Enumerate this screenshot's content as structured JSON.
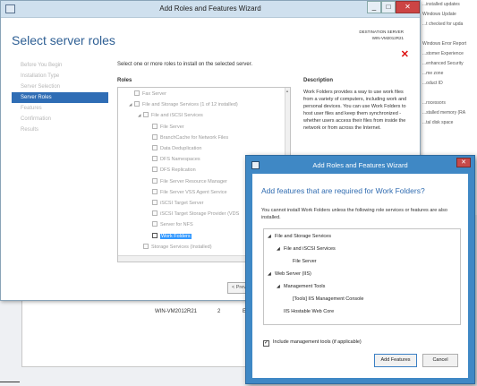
{
  "background": {
    "right_panel_lines": [
      "...installed updates",
      "Windows Update",
      "...t checked for upda",
      "",
      "Windows Error Report",
      "...stomer Experience",
      "...enhanced Security",
      "...me zone",
      "...oduct ID",
      "",
      "...rocessors",
      "...stalled memory (RA",
      "...tal disk space"
    ],
    "table_row": {
      "server": "WIN-VM2012R21",
      "num": "2",
      "col3": "Er"
    }
  },
  "wizard": {
    "title": "Add Roles and Features Wizard",
    "page_title": "Select server roles",
    "destination_label": "DESTINATION SERVER",
    "destination_value": "WIN-VM2012R21",
    "close_glyph": "✕",
    "nav": [
      "Before You Begin",
      "Installation Type",
      "Server Selection",
      "Server Roles",
      "Features",
      "Confirmation",
      "Results"
    ],
    "instruction": "Select one or more roles to install on the selected server.",
    "roles_label": "Roles",
    "description_label": "Description",
    "description": "Work Folders provides a way to use work files from a variety of computers, including work and personal devices. You can use Work Folders to host user files and keep them synchronized - whether users access their files from inside the network or from across the Internet.",
    "roles": [
      {
        "label": "Fax Server",
        "expand": "",
        "indent": 0
      },
      {
        "label": "File and Storage Services (1 of 12 installed)",
        "expand": "◢",
        "indent": 0
      },
      {
        "label": "File and iSCSI Services",
        "expand": "◢",
        "indent": 1
      },
      {
        "label": "File Server",
        "expand": "",
        "indent": 2
      },
      {
        "label": "BranchCache for Network Files",
        "expand": "",
        "indent": 2
      },
      {
        "label": "Data Deduplication",
        "expand": "",
        "indent": 2
      },
      {
        "label": "DFS Namespaces",
        "expand": "",
        "indent": 2
      },
      {
        "label": "DFS Replication",
        "expand": "",
        "indent": 2
      },
      {
        "label": "File Server Resource Manager",
        "expand": "",
        "indent": 2
      },
      {
        "label": "File Server VSS Agent Service",
        "expand": "",
        "indent": 2
      },
      {
        "label": "iSCSI Target Server",
        "expand": "",
        "indent": 2
      },
      {
        "label": "iSCSI Target Storage Provider (VDS",
        "expand": "",
        "indent": 2
      },
      {
        "label": "Server for NFS",
        "expand": "",
        "indent": 2
      },
      {
        "label": "Work Folders",
        "expand": "",
        "indent": 2,
        "selected": true
      },
      {
        "label": "Storage Services (Installed)",
        "expand": "",
        "indent": 1
      }
    ],
    "prev_button": "< Prev",
    "scroll_up": "▲",
    "scroll_down": "▼"
  },
  "dialog": {
    "title": "Add Roles and Features Wizard",
    "close_glyph": "✕",
    "heading": "Add features that are required for Work Folders?",
    "message": "You cannot install Work Folders unless the following role services or features are also installed.",
    "tree": [
      {
        "label": "File and Storage Services",
        "tri": "◢",
        "indent": 0
      },
      {
        "label": "File and iSCSI Services",
        "tri": "◢",
        "indent": 1
      },
      {
        "label": "File Server",
        "tri": "",
        "indent": 2
      },
      {
        "label": "Web Server (IIS)",
        "tri": "◢",
        "indent": 0
      },
      {
        "label": "Management Tools",
        "tri": "◢",
        "indent": 1
      },
      {
        "label": "[Tools] IIS Management Console",
        "tri": "",
        "indent": 2
      },
      {
        "label": "IIS Hostable Web Core",
        "tri": "",
        "indent": 1
      }
    ],
    "checkbox_label": "Include management tools (if applicable)",
    "checkbox_mark": "✓",
    "add_button": "Add Features",
    "cancel_button": "Cancel"
  }
}
